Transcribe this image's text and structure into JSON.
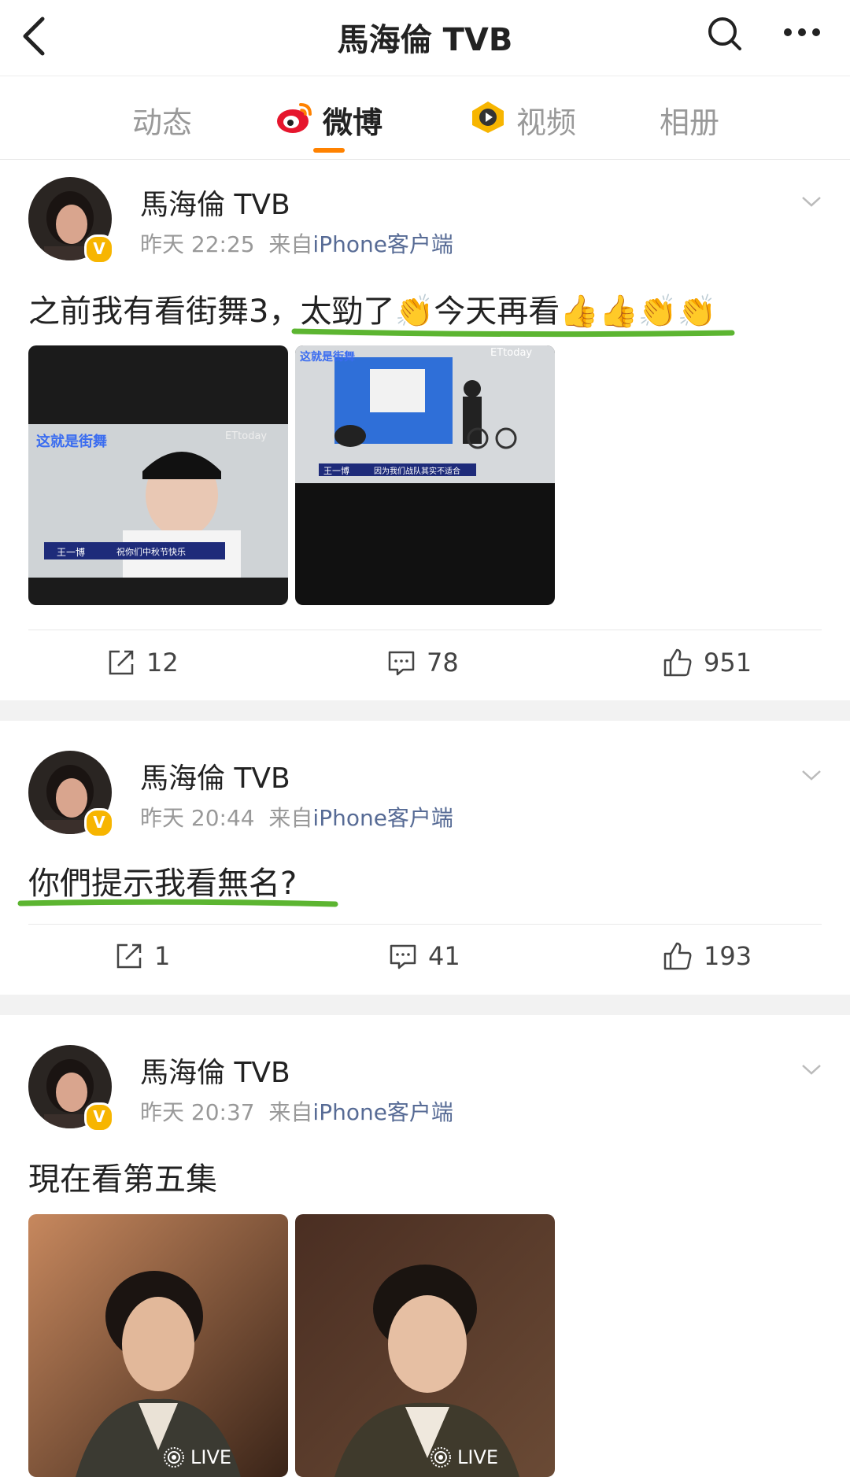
{
  "header": {
    "title": "馬海倫 TVB"
  },
  "tabs": [
    {
      "label": "动态"
    },
    {
      "label": "微博"
    },
    {
      "label": "视频"
    },
    {
      "label": "相册"
    }
  ],
  "posts": [
    {
      "author": "馬海倫 TVB",
      "time": "昨天 22:25",
      "via": "来自",
      "source": "iPhone客户端",
      "text": "之前我有看街舞3，太勁了👏今天再看👍👍👏👏",
      "media": [
        {
          "logo": "这就是街舞",
          "watermark": "ETtoday",
          "name_tag": "王一博",
          "caption": "祝你们中秋节快乐"
        },
        {
          "logo": "这就是街舞",
          "watermark": "ETtoday",
          "name_tag": "王一博",
          "caption": "因为我们战队其实不适合"
        }
      ],
      "reposts": "12",
      "comments": "78",
      "likes": "951"
    },
    {
      "author": "馬海倫 TVB",
      "time": "昨天 20:44",
      "via": "来自",
      "source": "iPhone客户端",
      "text": "你們提示我看無名?",
      "reposts": "1",
      "comments": "41",
      "likes": "193"
    },
    {
      "author": "馬海倫 TVB",
      "time": "昨天 20:37",
      "via": "来自",
      "source": "iPhone客户端",
      "text": "現在看第五集",
      "media": [
        {
          "badge": "LIVE"
        },
        {
          "badge": "LIVE"
        }
      ]
    }
  ],
  "icons": {
    "verified_badge": "V",
    "repost": "repost-icon",
    "comment": "comment-icon",
    "like": "like-icon",
    "live": "live-icon"
  },
  "colors": {
    "accent_orange": "#ff8200",
    "highlight_green": "#5cb531",
    "verified": "#f7b500",
    "source_link": "#576b95"
  }
}
